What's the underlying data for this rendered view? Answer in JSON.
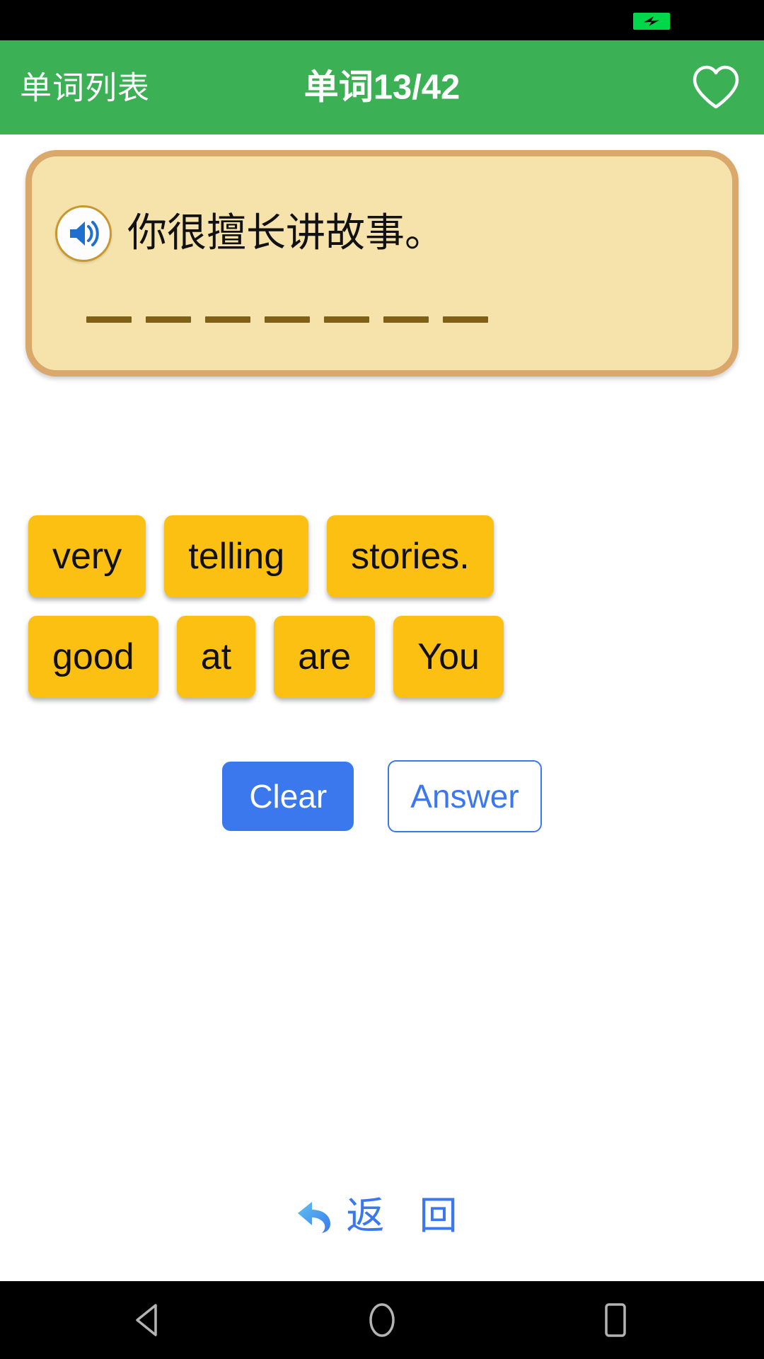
{
  "status_bar": {
    "battery_icon": "battery-charging-icon",
    "battery_color": "#00d84a"
  },
  "app_bar": {
    "back_label": "单词列表",
    "title": "单词13/42",
    "favorite_icon": "heart-outline-icon",
    "background_color": "#3cb054",
    "text_color": "#ffffff"
  },
  "question_card": {
    "speaker_icon": "speaker-volume-icon",
    "sentence": "你很擅长讲故事。",
    "blank_count": 7,
    "card_background": "#f6e3ab",
    "card_border": "#d9a86a",
    "blank_color": "#806016"
  },
  "word_tiles": {
    "tile_color": "#fcc013",
    "rows": [
      [
        "very",
        "telling",
        "stories."
      ],
      [
        "good",
        "at",
        "are",
        "You"
      ]
    ]
  },
  "actions": {
    "clear_label": "Clear",
    "answer_label": "Answer",
    "primary_color": "#3b78ee"
  },
  "back_link": {
    "icon": "undo-arrow-icon",
    "label": "返 回",
    "color": "#3b78ee"
  },
  "android_nav": {
    "back_icon": "nav-back-triangle-icon",
    "home_icon": "nav-home-circle-icon",
    "recents_icon": "nav-recents-square-icon"
  }
}
